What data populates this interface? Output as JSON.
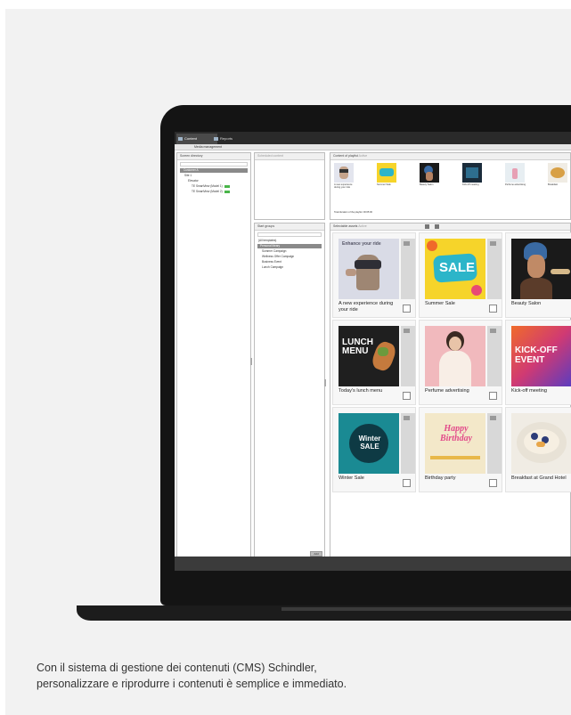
{
  "app": {
    "tabs": [
      {
        "label": "Content",
        "icon": "folder-icon"
      },
      {
        "label": "Reports",
        "icon": "chart-icon"
      }
    ],
    "subtab": "Media management"
  },
  "screens_panel": {
    "title": "Screen directory",
    "search_placeholder": "Search...",
    "tree": [
      {
        "label": "Customer A"
      },
      {
        "label": "Site 1"
      },
      {
        "label": "Elevator"
      },
      {
        "label": "TE SmartView (Model 1)"
      },
      {
        "label": "TE SmartView (Model 2)"
      }
    ]
  },
  "filter_panel": {
    "title": "Scheduled content"
  },
  "content_preview": {
    "title": "Content of playlist",
    "tab": "Active",
    "items": [
      {
        "label": "A new experience during your ride"
      },
      {
        "label": "Summer Sale"
      },
      {
        "label": "Beauty Salon"
      },
      {
        "label": "Kick-off meeting"
      },
      {
        "label": "Perfume advertising"
      },
      {
        "label": "Breakfast"
      }
    ],
    "total": "Total duration of the playlist: 00:05:00"
  },
  "groups_panel": {
    "title": "Start groups",
    "search_placeholder": "Search...",
    "items": [
      {
        "label": "(All templates)"
      },
      {
        "label": "Personal library"
      },
      {
        "label": "Summer Campaign"
      },
      {
        "label": "Wellness Offer Campaign"
      },
      {
        "label": "Business Event"
      },
      {
        "label": "Lunch Campaign"
      }
    ],
    "button": "Add"
  },
  "library": {
    "title": "Selectable assets",
    "tab": "Active",
    "cards": [
      {
        "label": "A new experience during your ride",
        "art_text": "Enhance your ride",
        "color": "#d9dbe6"
      },
      {
        "label": "Summer Sale",
        "art_text": "SALE",
        "color": "#f6d42a"
      },
      {
        "label": "Beauty Salon",
        "art_text": "",
        "color": "#1a1a1a"
      },
      {
        "label": "Today's lunch menu",
        "art_text": "LUNCH MENU",
        "color": "#1f1f1f"
      },
      {
        "label": "Perfume advertising",
        "art_text": "",
        "color": "#f1b9bd"
      },
      {
        "label": "Kick-off meeting",
        "art_text": "KICK-OFF EVENT",
        "color": "#d03a73"
      },
      {
        "label": "Winter Sale",
        "art_text": "Winter SALE",
        "color": "#1a8a93"
      },
      {
        "label": "Birthday party",
        "art_text": "Happy Birthday",
        "color": "#f3e8c9"
      },
      {
        "label": "Breakfast at Grand Hotel",
        "art_text": "",
        "color": "#f0ece4"
      }
    ]
  },
  "caption": {
    "line1": "Con il sistema di gestione dei contenuti (CMS) Schindler,",
    "line2": "personalizzare e riprodurre i contenuti è semplice e immediato."
  },
  "colors": {
    "laptop": "#141414",
    "accent_green": "#49b549",
    "selection": "#8a8a8a"
  }
}
